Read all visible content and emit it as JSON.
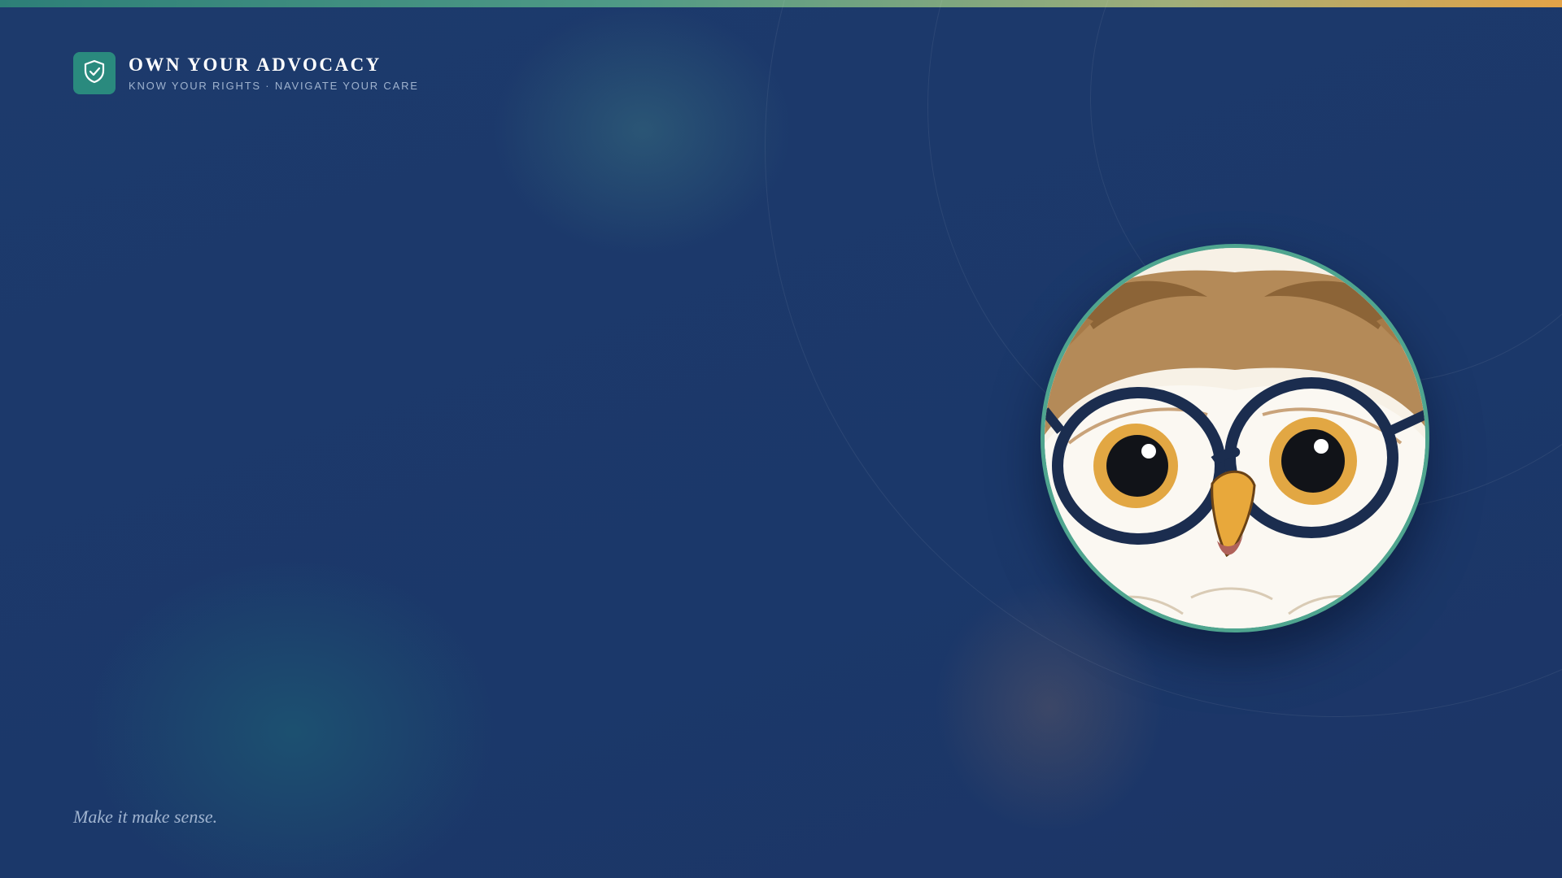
{
  "brand": {
    "title": "OWN YOUR ADVOCACY",
    "subtitle": "KNOW YOUR RIGHTS · NAVIGATE YOUR CARE",
    "icon": "shield-check-icon"
  },
  "hero": {
    "image": "owl-with-glasses-illustration"
  },
  "tagline": "Make it make sense.",
  "colors": {
    "background": "#1c3a6b",
    "accent_teal": "#2a8a7e",
    "ring_green": "#4fa58f",
    "accent_orange": "#e3a347",
    "muted_text": "#9fb3cf"
  }
}
